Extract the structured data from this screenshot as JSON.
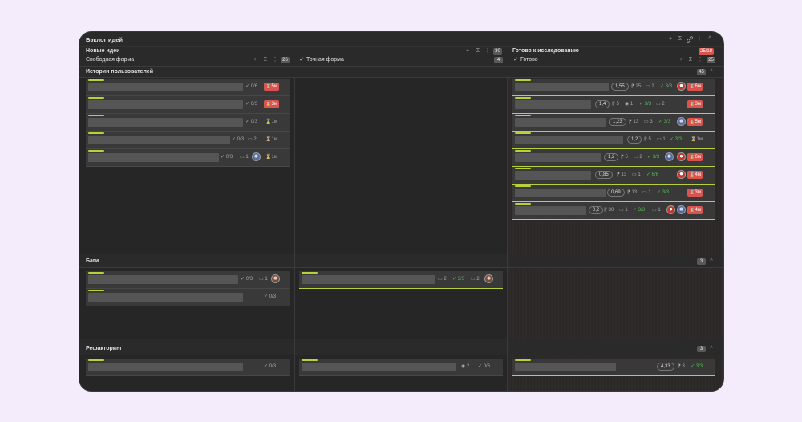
{
  "board": {
    "title": "Бэклог идей",
    "columns": [
      {
        "title": "Новые идеи",
        "count": "30",
        "sub": [
          {
            "title": "Свободная форма",
            "count": "26"
          },
          {
            "title": "Точная форма",
            "count": "4"
          }
        ]
      },
      {
        "title": "Готово к исследованию",
        "count": "25/18",
        "sub": [
          {
            "title": "Готово",
            "count": "25"
          }
        ]
      }
    ],
    "swimlanes": [
      {
        "title": "Истории пользователей",
        "count": "45"
      },
      {
        "title": "Баги",
        "count": "3"
      },
      {
        "title": "Рефакторинг",
        "count": "3"
      }
    ]
  },
  "icons": {
    "add": "+",
    "sum": "Σ",
    "more": "⋮",
    "link": "🔗",
    "collapse": "^",
    "check": "✓",
    "hourglass": "⌛",
    "comment": "▭",
    "pin": "⁋",
    "eye": "◉"
  },
  "cards": {
    "us_free": [
      {
        "check": "0/6",
        "tag": "5м",
        "red": true
      },
      {
        "check": "0/3",
        "tag": "3м",
        "red": true
      },
      {
        "check": "0/3",
        "tag": "1м",
        "red": false
      },
      {
        "check": "0/3",
        "comments": "2",
        "tag": "1м",
        "red": false
      },
      {
        "check": "0/3",
        "comments": "1",
        "tag": "1м",
        "red": false
      }
    ],
    "us_done": [
      {
        "score": "1,55",
        "pins": "25",
        "comments": "2",
        "check": "3/3",
        "tag": "6м"
      },
      {
        "score": "1,4",
        "pins": "5",
        "views": "1",
        "check": "3/3",
        "comments2": "2",
        "tag": "3м"
      },
      {
        "score": "1,23",
        "pins": "13",
        "comments": "3",
        "check": "3/3",
        "tag": "5м"
      },
      {
        "score": "1,2",
        "pins": "5",
        "comments": "1",
        "check": "3/3",
        "tag": "1м"
      },
      {
        "score": "1,2",
        "pins": "5",
        "comments": "2",
        "check": "3/3",
        "tag": "6м"
      },
      {
        "score": "0,85",
        "pins": "13",
        "comments": "1",
        "check": "6/6",
        "tag": "4м"
      },
      {
        "score": "0,69",
        "pins": "13",
        "comments": "1",
        "check": "3/3",
        "tag": "3м"
      },
      {
        "score": "0,2",
        "pins": "30",
        "comments": "1",
        "check": "3/3",
        "comments2": "1",
        "tag": "4м"
      }
    ],
    "bugs_free": [
      {
        "check": "0/3",
        "comments": "1"
      },
      {
        "check": "0/3"
      }
    ],
    "bugs_exact": [
      {
        "comments": "2",
        "check": "3/3",
        "comments2": "2"
      }
    ],
    "ref_free": [
      {
        "check": "0/3"
      }
    ],
    "ref_exact": [
      {
        "views": "2",
        "check": "0/6"
      }
    ],
    "ref_done": [
      {
        "score": "4,33",
        "pins": "3",
        "check": "3/3"
      }
    ]
  }
}
